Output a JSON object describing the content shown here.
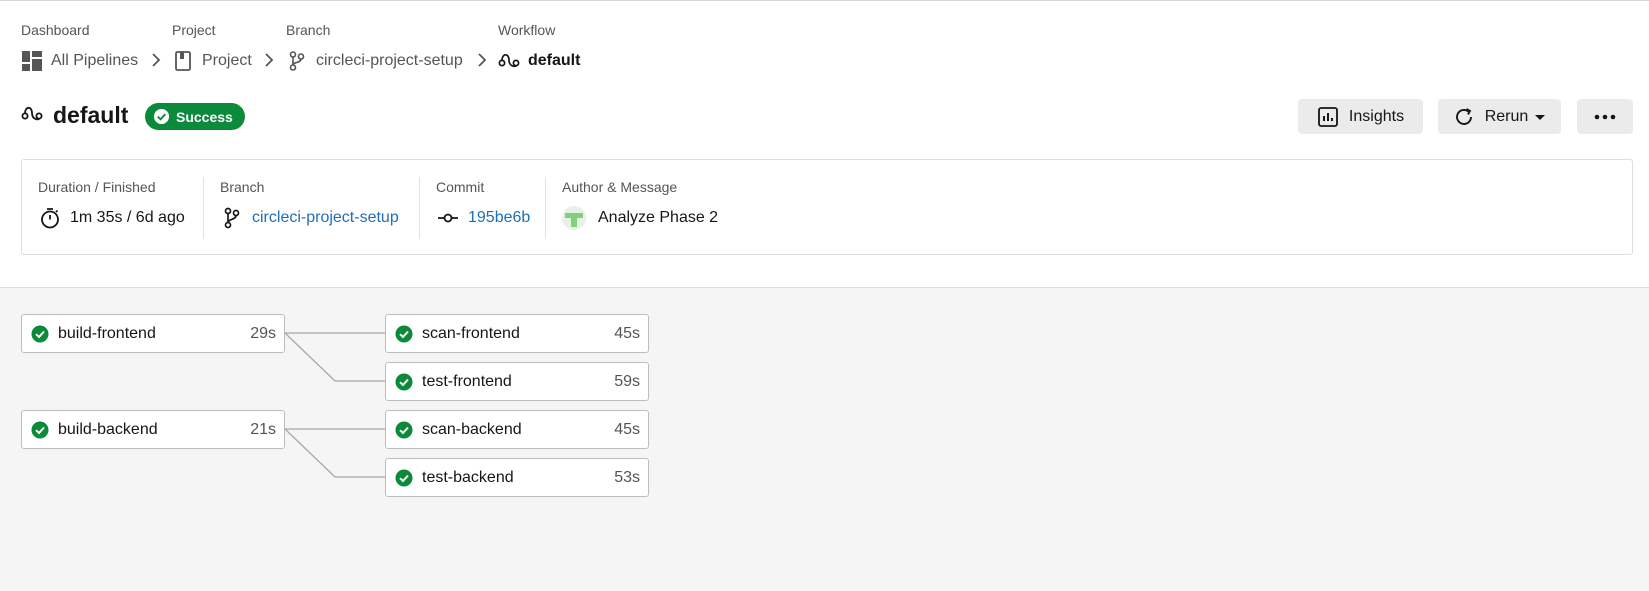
{
  "breadcrumb": {
    "dashboard": {
      "category": "Dashboard",
      "label": "All Pipelines"
    },
    "project": {
      "category": "Project",
      "label": "Project"
    },
    "branch": {
      "category": "Branch",
      "label": "circleci-project-setup"
    },
    "workflow": {
      "category": "Workflow",
      "label": "default"
    }
  },
  "header": {
    "title": "default",
    "status": "Success",
    "status_color": "#0a8a3a",
    "insights_label": "Insights",
    "rerun_label": "Rerun",
    "more_icon": "more-horizontal-icon"
  },
  "info": {
    "duration": {
      "caption": "Duration / Finished",
      "value": "1m 35s / 6d ago",
      "icon": "stopwatch-icon"
    },
    "branch": {
      "caption": "Branch",
      "value": "circleci-project-setup",
      "icon": "git-branch-icon"
    },
    "commit": {
      "caption": "Commit",
      "value": "195be6b",
      "icon": "git-commit-icon"
    },
    "author": {
      "caption": "Author & Message",
      "message": "Analyze Phase 2",
      "icon": "avatar"
    }
  },
  "jobs": [
    {
      "name": "build-frontend",
      "duration": "29s",
      "status": "success"
    },
    {
      "name": "scan-frontend",
      "duration": "45s",
      "status": "success"
    },
    {
      "name": "test-frontend",
      "duration": "59s",
      "status": "success"
    },
    {
      "name": "build-backend",
      "duration": "21s",
      "status": "success"
    },
    {
      "name": "scan-backend",
      "duration": "45s",
      "status": "success"
    },
    {
      "name": "test-backend",
      "duration": "53s",
      "status": "success"
    }
  ],
  "colors": {
    "link": "#1f6fb5",
    "success": "#0a8a3a",
    "graph_bg": "#f5f5f5"
  }
}
